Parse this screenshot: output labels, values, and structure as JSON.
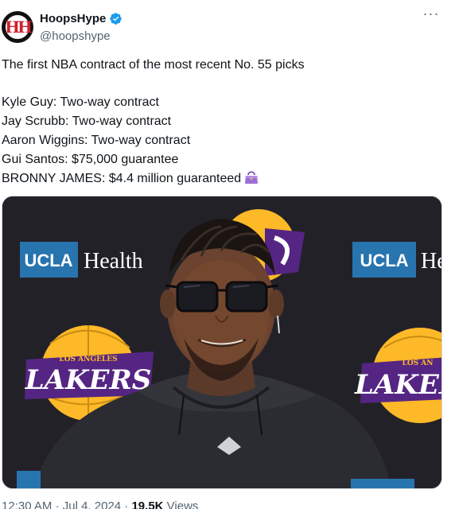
{
  "author": {
    "name": "HoopsHype",
    "handle": "@hoopshype",
    "avatar_text": "HH"
  },
  "tweet": {
    "lines": [
      "The first NBA contract of the most recent No. 55 picks",
      "",
      "Kyle Guy: Two-way contract",
      "Jay Scrubb: Two-way contract",
      "Aaron Wiggins: Two-way contract",
      "Gui Santos: $75,000 guarantee",
      "BRONNY JAMES: $4.4 million guaranteed"
    ]
  },
  "media": {
    "backdrop_text_left": "UCLA",
    "backdrop_health_left": "Health",
    "backdrop_text_right": "UCLA",
    "backdrop_health_right": "He",
    "logo_text": "LAKERS",
    "logo_small": "LOS ANGELES",
    "logo_small_right": "LOS AN",
    "logo_text_right": "LAKER"
  },
  "meta": {
    "time": "12:30 AM",
    "separator": "·",
    "date": "Jul 4, 2024",
    "views_count": "19.5K",
    "views_label": "Views"
  },
  "colors": {
    "verified": "#1d9bf0",
    "ucla_blue": "#2774ae",
    "lakers_purple": "#552583",
    "lakers_gold": "#fdb927",
    "backdrop": "#1f1e24",
    "text_secondary": "#536471"
  }
}
